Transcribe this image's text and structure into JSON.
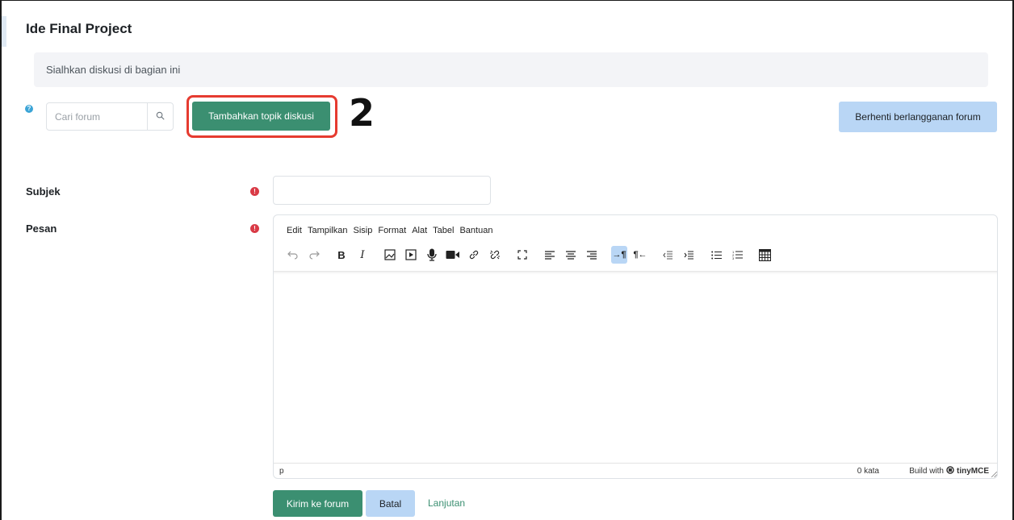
{
  "page": {
    "title": "Ide Final Project",
    "intro": "Sialhkan diskusi di bagian ini",
    "step_number": "2"
  },
  "forum_controls": {
    "search_placeholder": "Cari forum",
    "add_topic_label": "Tambahkan topik diskusi",
    "unsubscribe_label": "Berhenti berlangganan forum"
  },
  "form": {
    "subject_label": "Subjek",
    "subject_value": "",
    "message_label": "Pesan"
  },
  "editor": {
    "menu": [
      "Edit",
      "Tampilkan",
      "Sisip",
      "Format",
      "Alat",
      "Tabel",
      "Bantuan"
    ],
    "status_path": "p",
    "word_count": "0 kata",
    "build_with": "Build with",
    "brand": "tinyMCE"
  },
  "actions": {
    "submit_label": "Kirim ke forum",
    "cancel_label": "Batal",
    "advanced_label": "Lanjutan"
  },
  "colors": {
    "primary_green": "#3b8f71",
    "light_blue": "#b9d6f5",
    "highlight_red": "#e63b30",
    "required_red": "#d93a46",
    "info_blue": "#3ba4d6"
  }
}
